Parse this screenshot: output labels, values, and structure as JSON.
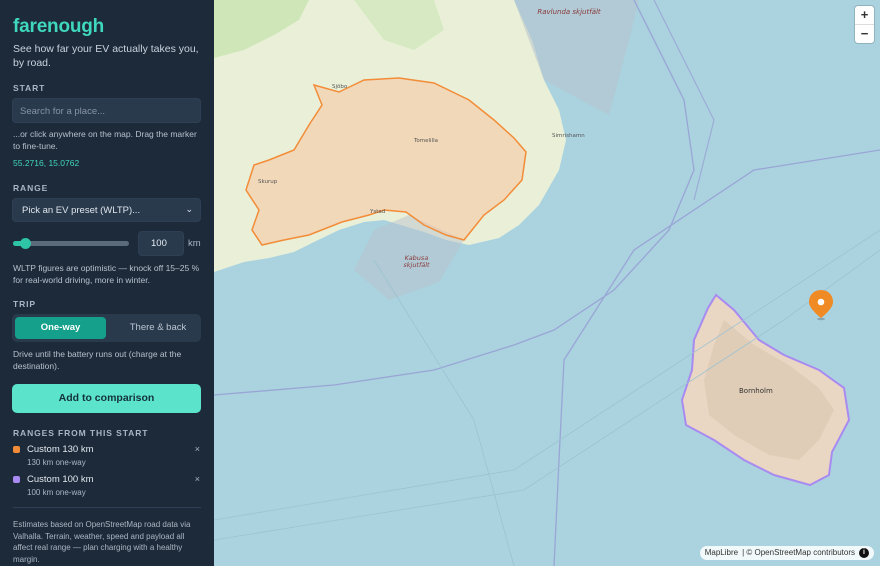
{
  "app": {
    "name": "farenough",
    "tagline": "See how far your EV actually takes you, by road."
  },
  "start": {
    "label": "START",
    "search_placeholder": "Search for a place...",
    "hint": "...or click anywhere on the map. Drag the marker to fine-tune.",
    "coords": "55.2716, 15.0762"
  },
  "range": {
    "label": "RANGE",
    "preset_selected": "Pick an EV preset (WLTP)...",
    "slider_fraction": 0.1,
    "value": "100",
    "unit": "km",
    "note": "WLTP figures are optimistic — knock off 15–25 % for real-world driving, more in winter."
  },
  "trip": {
    "label": "TRIP",
    "options": [
      "One-way",
      "There & back"
    ],
    "selected": "One-way",
    "note": "Drive until the battery runs out (charge at the destination)."
  },
  "add_button": "Add to comparison",
  "comparison": {
    "label": "RANGES FROM THIS START",
    "items": [
      {
        "name": "Custom 130 km",
        "sub": "130 km one-way",
        "color": "#f28c38",
        "remove": "×"
      },
      {
        "name": "Custom 100 km",
        "sub": "100 km one-way",
        "color": "#a98af0",
        "remove": "×"
      }
    ]
  },
  "footer_note": "Estimates based on OpenStreetMap road data via Valhalla. Terrain, weather, speed and payload all affect real range — plan charging with a healthy margin.",
  "map": {
    "zoom_in": "+",
    "zoom_out": "−",
    "attribution_lib": "MapLibre",
    "attribution_osm": "| © OpenStreetMap contributors",
    "info_icon": "i",
    "labels": {
      "ravlunda": "Ravlunda skjutfält",
      "kabusa": "Kabusa skjutfält",
      "bornholm": "Bornholm",
      "ystad": "Ystad",
      "tomelilla": "Tomelilla",
      "simrishamn": "Simrishamn",
      "skurup": "Skurup",
      "sjobo": "Sjöbo"
    },
    "colors": {
      "water": "#aad3df",
      "land": "#f2efe9",
      "range_130": "#f28c38",
      "range_100": "#a98af0",
      "marker": "#f08a24"
    }
  }
}
